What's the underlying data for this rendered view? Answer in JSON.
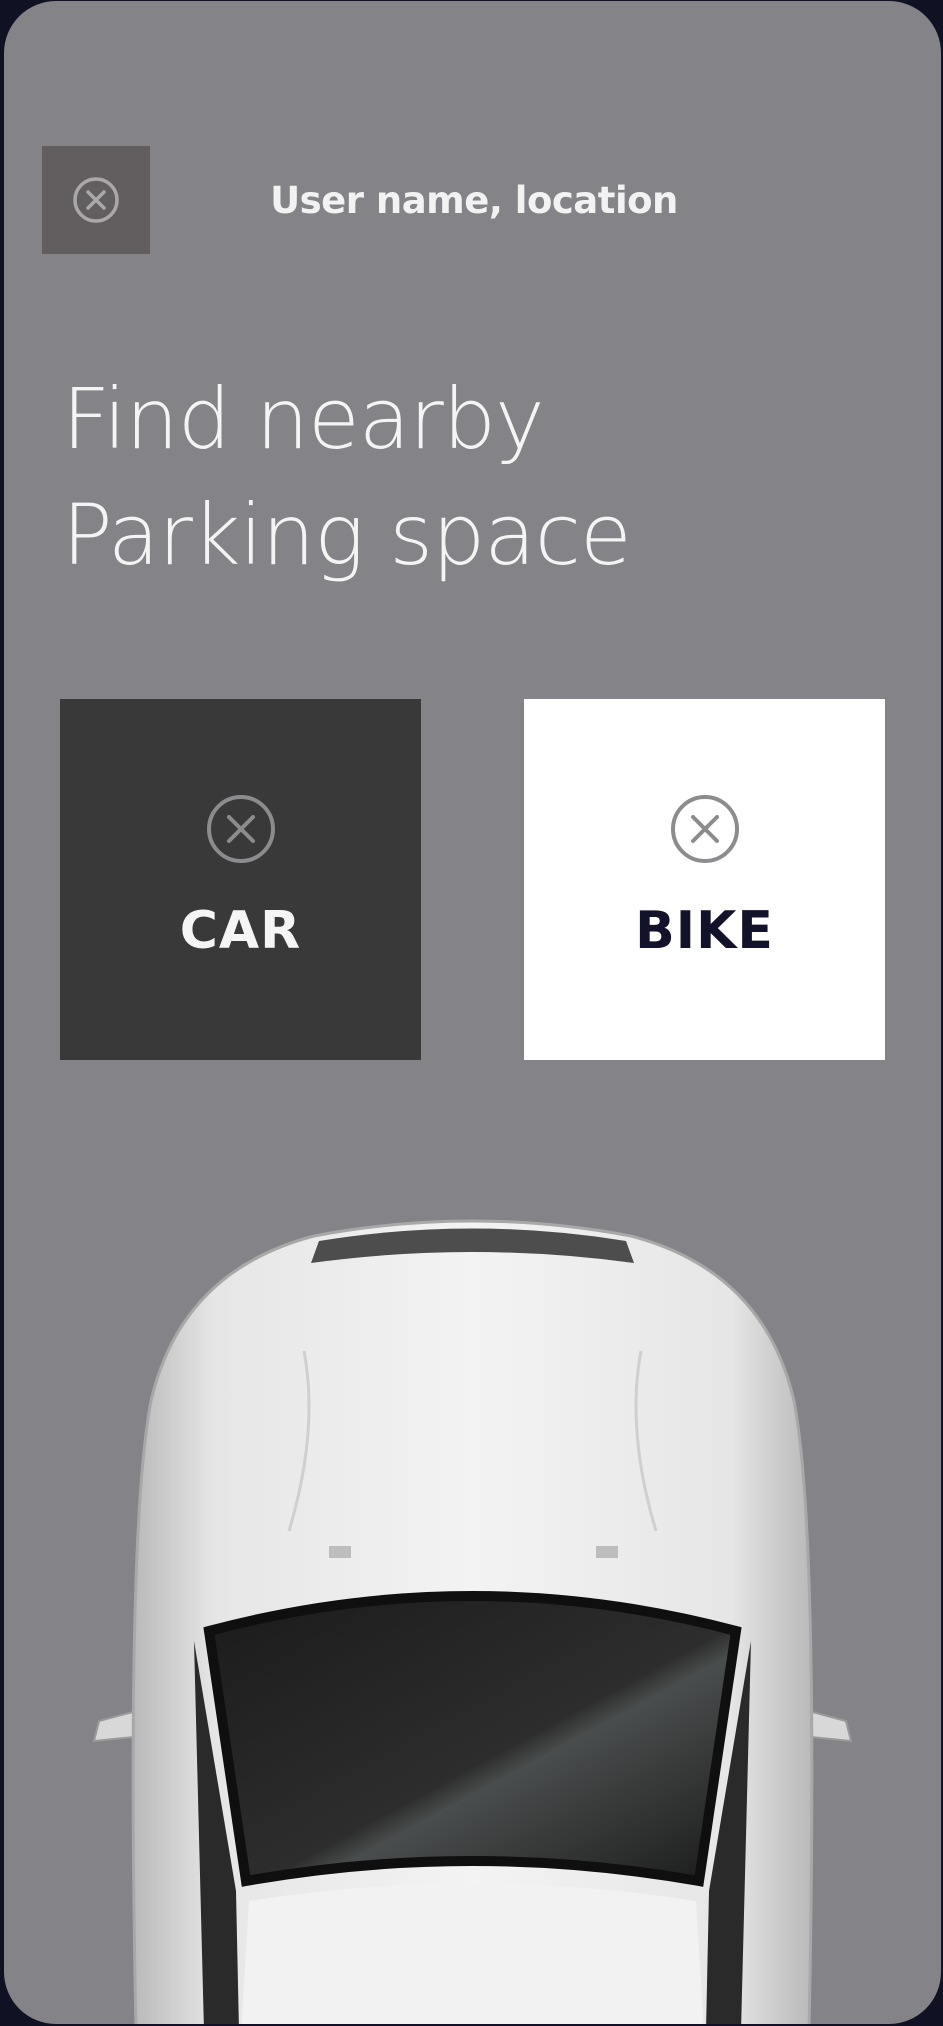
{
  "header": {
    "close_icon": "close-circle-icon",
    "title": "User name, location"
  },
  "headline": {
    "line1": "Find nearby",
    "line2": "Parking space"
  },
  "vehicle_options": [
    {
      "label": "CAR",
      "icon": "close-circle-icon",
      "selected": true
    },
    {
      "label": "BIKE",
      "icon": "close-circle-icon",
      "selected": false
    }
  ],
  "colors": {
    "background": "#838388",
    "selected_tile": "#3a393a",
    "unselected_tile": "#ffffff",
    "close_button": "#625e5f"
  },
  "illustration": "car-top-view"
}
